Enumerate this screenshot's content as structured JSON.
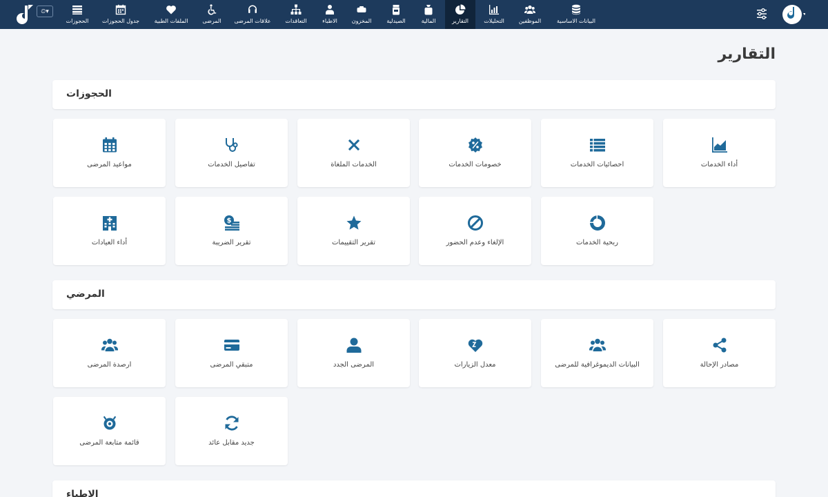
{
  "nav": {
    "items": [
      {
        "label": "البيانات الاساسية",
        "icon": "database-icon"
      },
      {
        "label": "الموظفين",
        "icon": "users-icon"
      },
      {
        "label": "التحليلات",
        "icon": "chart-icon"
      },
      {
        "label": "التقارير",
        "icon": "pie-chart-icon"
      },
      {
        "label": "المالية",
        "icon": "money-bag-icon"
      },
      {
        "label": "الصيدلية",
        "icon": "medicine-icon"
      },
      {
        "label": "المخزون",
        "icon": "box-icon"
      },
      {
        "label": "الاطباء",
        "icon": "doctor-icon"
      },
      {
        "label": "التعاقدات",
        "icon": "sitemap-icon"
      },
      {
        "label": "علاقات المرضى",
        "icon": "headset-icon"
      },
      {
        "label": "المرضى",
        "icon": "wheelchair-icon"
      },
      {
        "label": "الملفات الطبية",
        "icon": "heart-icon"
      },
      {
        "label": "جدول الحجوزات",
        "icon": "calendar-icon"
      },
      {
        "label": "الحجوزات",
        "icon": "list-icon"
      }
    ],
    "active_index": 3,
    "clock_caret": "▾"
  },
  "page": {
    "title": "التقارير"
  },
  "sections": {
    "bookings": {
      "title": "الحجوزات",
      "cards": [
        {
          "label": "أداء الخدمات",
          "icon": "area-chart-icon"
        },
        {
          "label": "احصائيات الخدمات",
          "icon": "list-icon"
        },
        {
          "label": "خصومات الخدمات",
          "icon": "percent-badge-icon"
        },
        {
          "label": "الخدمات الملغاة",
          "icon": "times-icon"
        },
        {
          "label": "تفاصيل الخدمات",
          "icon": "stethoscope-icon"
        },
        {
          "label": "مواعيد المرضى",
          "icon": "calendar-icon"
        },
        {
          "label": "ربحية الخدمات",
          "icon": "donut-icon"
        },
        {
          "label": "الإلغاء وعدم الحضور",
          "icon": "ban-icon"
        },
        {
          "label": "تقرير التقييمات",
          "icon": "star-icon"
        },
        {
          "label": "تقرير الضريبة",
          "icon": "money-stack-icon"
        },
        {
          "label": "أداء العيادات",
          "icon": "hospital-icon"
        }
      ]
    },
    "patients": {
      "title": "المرضي",
      "cards": [
        {
          "label": "مصادر الإحالة",
          "icon": "share-icon"
        },
        {
          "label": "البيانات الديموغرافية للمرضى",
          "icon": "users-icon"
        },
        {
          "label": "معدل الزيارات",
          "icon": "heart-z-icon"
        },
        {
          "label": "المرضى الجدد",
          "icon": "user-icon"
        },
        {
          "label": "متبقي المرضى",
          "icon": "credit-card-icon"
        },
        {
          "label": "ارصدة المرضى",
          "icon": "users-icon"
        },
        {
          "label": "جديد مقابل عائد",
          "icon": "refresh-icon"
        },
        {
          "label": "قائمة متابعة المرضى",
          "icon": "follow-up-icon"
        }
      ]
    },
    "doctors": {
      "title": "الاطباء"
    }
  },
  "colors": {
    "navbar": "#1d3a5c",
    "accent": "#1f6a9a",
    "background": "#f3f5f8"
  }
}
